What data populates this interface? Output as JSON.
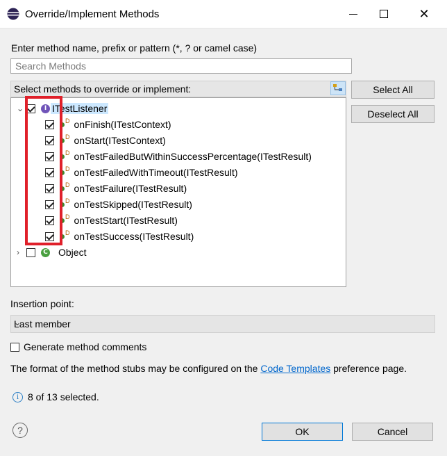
{
  "window": {
    "title": "Override/Implement Methods",
    "min_glyph": "",
    "close_glyph": "✕"
  },
  "prompt_label": "Enter method name, prefix or pattern (*, ? or camel case)",
  "search": {
    "placeholder": "Search Methods",
    "value": ""
  },
  "list_label": "Select methods to override or implement:",
  "buttons": {
    "select_all": "Select All",
    "deselect_all": "Deselect All",
    "ok": "OK",
    "cancel": "Cancel"
  },
  "tree": {
    "root": {
      "label": "ITestListener",
      "checked": true,
      "expanded": true,
      "icon_letter": "I"
    },
    "methods": [
      {
        "label": "onFinish(ITestContext)",
        "checked": true
      },
      {
        "label": "onStart(ITestContext)",
        "checked": true
      },
      {
        "label": "onTestFailedButWithinSuccessPercentage(ITestResult)",
        "checked": true
      },
      {
        "label": "onTestFailedWithTimeout(ITestResult)",
        "checked": true
      },
      {
        "label": "onTestFailure(ITestResult)",
        "checked": true
      },
      {
        "label": "onTestSkipped(ITestResult)",
        "checked": true
      },
      {
        "label": "onTestStart(ITestResult)",
        "checked": true
      },
      {
        "label": "onTestSuccess(ITestResult)",
        "checked": true
      }
    ],
    "abstract_marker": "D",
    "object_node": {
      "label": "Object",
      "checked": false,
      "expanded": false,
      "icon_letter": "C"
    }
  },
  "insertion_point": {
    "label": "Insertion point:",
    "value": "Last member"
  },
  "generate_comments": {
    "label": "Generate method comments",
    "checked": false
  },
  "format_note": {
    "before": "The format of the method stubs may be configured on the ",
    "link": "Code Templates",
    "after": " preference page."
  },
  "status": {
    "text": "8 of 13 selected.",
    "icon_glyph": "i"
  },
  "help_glyph": "?",
  "colors": {
    "highlight": "#e0202a",
    "selection": "#cce8ff",
    "link": "#0066cc",
    "interface_icon": "#7054b9",
    "class_icon": "#4aa040",
    "method_icon": "#3c8a2e"
  }
}
